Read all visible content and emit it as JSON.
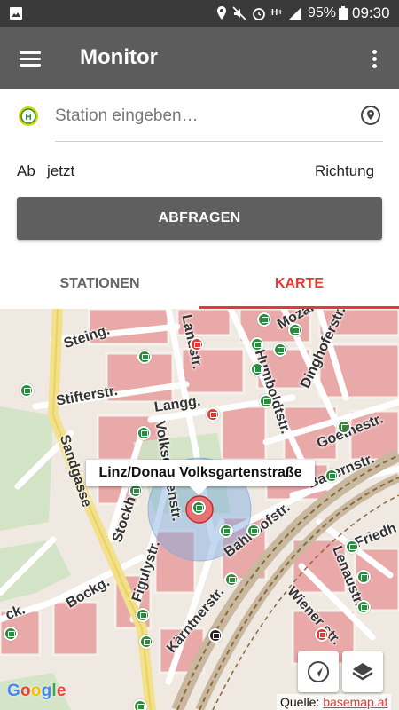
{
  "status_bar": {
    "battery": "95%",
    "time": "09:30",
    "icons": [
      "gallery-icon",
      "location-icon",
      "mute-icon",
      "alarm-icon",
      "network-h-plus-icon",
      "signal-icon",
      "battery-icon"
    ],
    "network_label": "H+"
  },
  "app_bar": {
    "title": "Monitor",
    "menu_icon": "hamburger-menu-icon",
    "overflow_icon": "more-vert-icon"
  },
  "form": {
    "station_placeholder": "Station eingeben…",
    "station_value": "",
    "station_icon": "H",
    "ab_label": "Ab",
    "ab_value": "jetzt",
    "direction_label": "Richtung",
    "query_button": "ABFRAGEN"
  },
  "tabs": [
    {
      "label": "STATIONEN",
      "active": false
    },
    {
      "label": "KARTE",
      "active": true
    }
  ],
  "map": {
    "selected_station": "Linz/Donau Volksgartenstraße",
    "streets": {
      "steing": "Steing.",
      "stifterstr": "Stifterstr.",
      "langg": "Langg.",
      "sandgasse": "Sandgasse",
      "humboldtstr": "Humboldtstr.",
      "goethestr": "Goethestr.",
      "dinghoferstr": "Dinghoferstr.",
      "bauernstr": "Bauernstr.",
      "friedhofstr": "Friedh",
      "lenaustr": "Lenaustr.",
      "wienerstr": "Wiener str.",
      "stockhofstr": "Stockhofstr.",
      "figulystr": "Figulystr.",
      "bockg": "Bockg.",
      "kaerntnerstr": "Kärntnerstr.",
      "bahnhofstr": "Bahnhofstr.",
      "landstr": "Landstr.",
      "volksgartenstr": "Volksgartenstr.",
      "mozartstr": "Mozartstr.",
      "ck": "ck."
    },
    "attribution_prefix": "Quelle:",
    "attribution_link": "basemap.at",
    "google_logo": "Google",
    "buttons": {
      "locate": "my-location-icon",
      "layers": "layers-icon"
    }
  },
  "colors": {
    "accent": "#e53935",
    "toolbar": "#5c5c5c",
    "status_bar": "#3a3a3a",
    "bus_stop": "#2e8b3e",
    "tram_stop": "#e53935",
    "h_icon": "#d4d800"
  }
}
